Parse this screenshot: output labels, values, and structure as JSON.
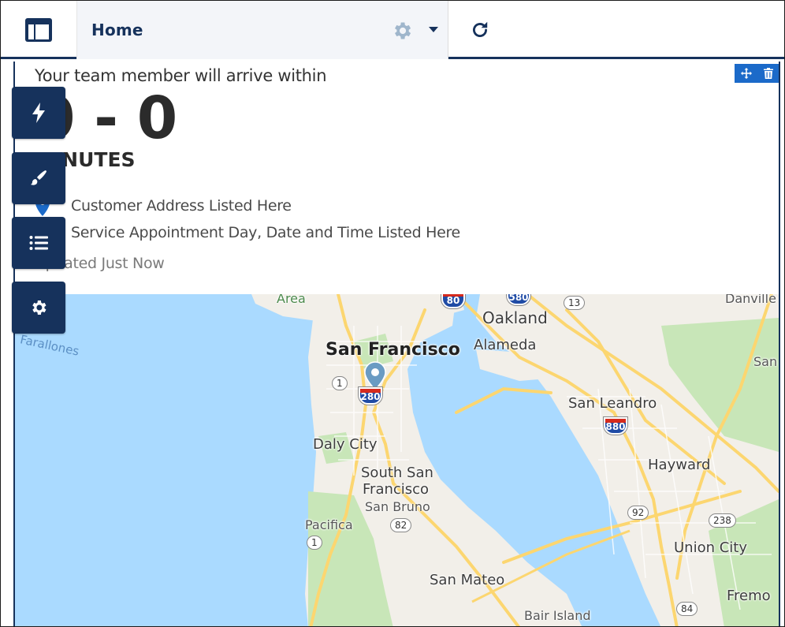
{
  "header": {
    "tab_label": "Home"
  },
  "card": {
    "arrive_text": "Your team member will arrive within",
    "eta_value": "0 - 0",
    "eta_unit": "MINUTES",
    "address": "Customer Address Listed Here",
    "appointment": "Service Appointment Day, Date and Time Listed Here",
    "updated": "Updated Just Now"
  },
  "map": {
    "labels": {
      "area": "Area",
      "farallones": "Farallones",
      "oakland": "Oakland",
      "danville": "Danville",
      "san_francisco": "San Francisco",
      "alameda": "Alameda",
      "san": "San",
      "san_leandro": "San Leandro",
      "daly_city": "Daly City",
      "south_san_francisco_1": "South San",
      "south_san_francisco_2": "Francisco",
      "san_bruno": "San Bruno",
      "hayward": "Hayward",
      "pacifica": "Pacifica",
      "union_city": "Union City",
      "san_mateo": "San Mateo",
      "fremont": "Fremo",
      "bair_island": "Bair Island"
    },
    "shields": {
      "i80": "80",
      "i580": "580",
      "r13": "13",
      "r1a": "1",
      "i280": "280",
      "i880": "880",
      "r92": "92",
      "r82": "82",
      "r238": "238",
      "r1b": "1",
      "r84": "84"
    }
  },
  "icons": {
    "logo": "layout-icon",
    "tab_gear": "gear-icon",
    "refresh": "refresh-icon",
    "side": [
      "lightning-icon",
      "brush-icon",
      "list-icon",
      "gear-icon"
    ]
  },
  "colors": {
    "navy": "#16325c",
    "accent_blue": "#1b6ac9",
    "water": "#aadaff",
    "land": "#f2efe9",
    "park": "#c8e6b8",
    "road": "#fcd670",
    "pin": "#6a9bc3"
  }
}
